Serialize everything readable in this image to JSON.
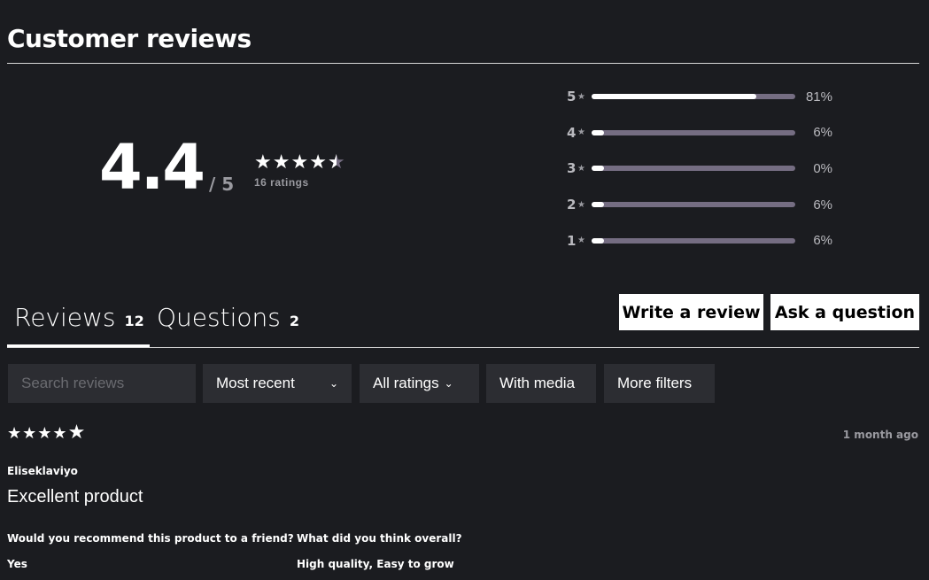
{
  "title": "Customer reviews",
  "summary": {
    "average": "4.4",
    "out_of": "/ 5",
    "stars": 4.4,
    "count": "16 ratings"
  },
  "distribution": [
    {
      "label": "5",
      "pct": 81,
      "text": "81%"
    },
    {
      "label": "4",
      "pct": 6,
      "text": "6%"
    },
    {
      "label": "3",
      "pct": 0,
      "text": "0%"
    },
    {
      "label": "2",
      "pct": 6,
      "text": "6%"
    },
    {
      "label": "1",
      "pct": 6,
      "text": "6%"
    }
  ],
  "tabs": [
    {
      "label": "Reviews",
      "count": "12"
    },
    {
      "label": "Questions",
      "count": "2"
    }
  ],
  "buttons": {
    "write": "Write a review",
    "ask": "Ask a question"
  },
  "filters": {
    "search_placeholder": "Search reviews",
    "sort": "Most recent",
    "ratings": "All ratings",
    "media": "With media",
    "more": "More filters"
  },
  "review": {
    "stars": 5,
    "date": "1 month ago",
    "author": "Eliseklaviyo",
    "title": "Excellent product",
    "q1": "Would you recommend this product to a friend?",
    "a1": "Yes",
    "q2": "What did you think overall?",
    "a2": "High quality, Easy to grow"
  },
  "colors": {
    "background": "#1b1c20",
    "track": "#756d82",
    "control": "#2c2d32"
  }
}
